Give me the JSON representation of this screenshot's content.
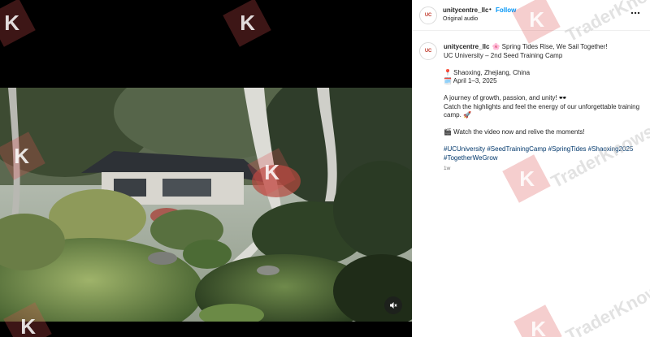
{
  "post": {
    "username": "unitycentre_llc",
    "separator": "•",
    "follow_label": "Follow",
    "audio_label": "Original audio",
    "avatar_text": "UC",
    "icons": {
      "more": "more-options-icon",
      "mute": "muted-speaker-icon"
    }
  },
  "caption": {
    "username": "unitycentre_llc",
    "title": "🌸 Spring Tides Rise, We Sail Together!",
    "subtitle": "UC University – 2nd Seed Training Camp",
    "location": "📍 Shaoxing, Zhejiang, China",
    "dates": "🗓️ April 1–3, 2025",
    "journey": "A journey of growth, passion, and unity! 🕶️",
    "highlights": "Catch the highlights and feel the energy of our unforgettable training camp. 🚀",
    "cta": "🎬 Watch the video now and relive the moments!",
    "hashtags": [
      "#UCUniversity",
      "#SeedTrainingCamp",
      "#SpringTides",
      "#Shaoxing2025",
      "#TogetherWeGrow"
    ],
    "time_ago": "1w"
  },
  "watermark": {
    "badge_letter": "K",
    "text": "TraderKnows"
  },
  "colors": {
    "follow": "#0095f6",
    "hashtag": "#00376b",
    "text": "#262626",
    "muted": "#737373"
  }
}
